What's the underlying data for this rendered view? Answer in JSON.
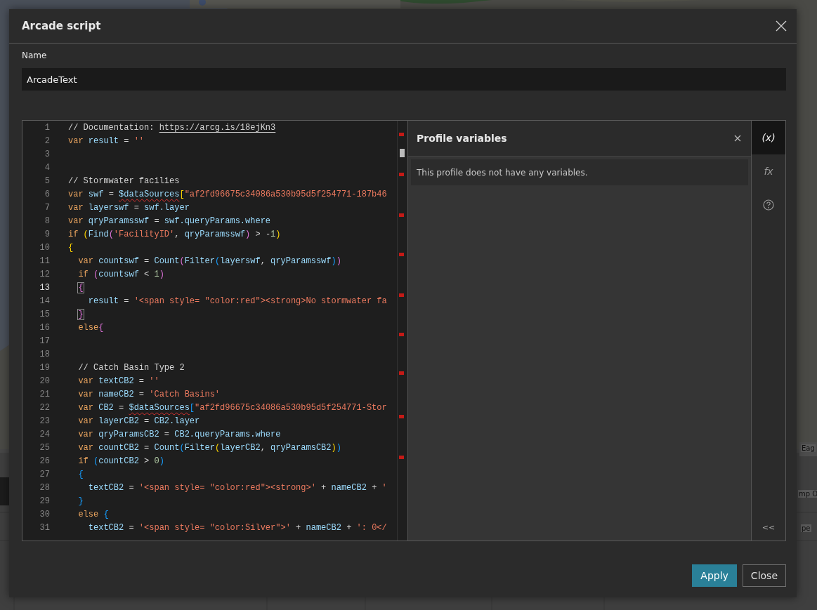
{
  "background": {
    "fragments": [
      "Eag",
      "mp O",
      "pe"
    ]
  },
  "dialog": {
    "title": "Arcade script",
    "name_label": "Name",
    "name_value": "ArcadeText",
    "editor": {
      "lines": [
        {
          "number": "1",
          "current": false,
          "tokens": [
            {
              "text": "// Documentation: ",
              "kind": "cm"
            },
            {
              "text": "https://arcg.is/18ejKn3",
              "kind": "link"
            }
          ]
        },
        {
          "number": "2",
          "current": false,
          "tokens": [
            {
              "text": "var ",
              "kind": "kw"
            },
            {
              "text": "result",
              "kind": "id"
            },
            {
              "text": " = ",
              "kind": "op"
            },
            {
              "text": "''",
              "kind": "str"
            }
          ]
        },
        {
          "number": "3",
          "current": false
        },
        {
          "number": "4",
          "current": false
        },
        {
          "number": "5",
          "current": false,
          "tokens": [
            {
              "text": "// Stormwater facilies",
              "kind": "cm"
            }
          ]
        },
        {
          "number": "6",
          "current": false,
          "tokens": [
            {
              "text": "var ",
              "kind": "kw"
            },
            {
              "text": "swf",
              "kind": "id"
            },
            {
              "text": " = ",
              "kind": "op"
            },
            {
              "text": "$dataSources",
              "kind": "err"
            },
            {
              "text": "[",
              "kind": "p1"
            },
            {
              "text": "\"af2fd96675c34086a530b95d5f254771-187b46",
              "kind": "str"
            }
          ]
        },
        {
          "number": "7",
          "current": false,
          "tokens": [
            {
              "text": "var ",
              "kind": "kw"
            },
            {
              "text": "layerswf",
              "kind": "id"
            },
            {
              "text": " = ",
              "kind": "op"
            },
            {
              "text": "swf.layer",
              "kind": "id"
            }
          ]
        },
        {
          "number": "8",
          "current": false,
          "tokens": [
            {
              "text": "var ",
              "kind": "kw"
            },
            {
              "text": "qryParamsswf",
              "kind": "id"
            },
            {
              "text": " = ",
              "kind": "op"
            },
            {
              "text": "swf.queryParams.where",
              "kind": "id"
            }
          ]
        },
        {
          "number": "9",
          "current": false,
          "tokens": [
            {
              "text": "if ",
              "kind": "kw"
            },
            {
              "text": "(",
              "kind": "p1"
            },
            {
              "text": "Find",
              "kind": "fn"
            },
            {
              "text": "(",
              "kind": "p2"
            },
            {
              "text": "'FacilityID'",
              "kind": "str"
            },
            {
              "text": ", ",
              "kind": "op"
            },
            {
              "text": "qryParamsswf",
              "kind": "id"
            },
            {
              "text": ")",
              "kind": "p2"
            },
            {
              "text": " > -",
              "kind": "op"
            },
            {
              "text": "1",
              "kind": "num"
            },
            {
              "text": ")",
              "kind": "p1"
            }
          ]
        },
        {
          "number": "10",
          "current": false,
          "tokens": [
            {
              "text": "{",
              "kind": "p1"
            }
          ]
        },
        {
          "number": "11",
          "current": false,
          "tokens": [
            {
              "text": "  var ",
              "kind": "kw"
            },
            {
              "text": "countswf",
              "kind": "id"
            },
            {
              "text": " = ",
              "kind": "op"
            },
            {
              "text": "Count",
              "kind": "fn"
            },
            {
              "text": "(",
              "kind": "p2"
            },
            {
              "text": "Filter",
              "kind": "fn"
            },
            {
              "text": "(",
              "kind": "p3"
            },
            {
              "text": "layerswf",
              "kind": "id"
            },
            {
              "text": ", ",
              "kind": "op"
            },
            {
              "text": "qryParamsswf",
              "kind": "id"
            },
            {
              "text": ")",
              "kind": "p3"
            },
            {
              "text": ")",
              "kind": "p2"
            }
          ]
        },
        {
          "number": "12",
          "current": false,
          "tokens": [
            {
              "text": "  if ",
              "kind": "kw"
            },
            {
              "text": "(",
              "kind": "p2"
            },
            {
              "text": "countswf",
              "kind": "id"
            },
            {
              "text": " < ",
              "kind": "op"
            },
            {
              "text": "1",
              "kind": "num"
            },
            {
              "text": ")",
              "kind": "p2"
            }
          ]
        },
        {
          "number": "13",
          "current": true,
          "tokens": [
            {
              "text": "  {",
              "kind": "p2m"
            }
          ]
        },
        {
          "number": "14",
          "current": false,
          "tokens": [
            {
              "text": "    result",
              "kind": "id"
            },
            {
              "text": " = ",
              "kind": "op"
            },
            {
              "text": "'<span style= \"color:red\"><strong>No stormwater fa",
              "kind": "str"
            }
          ]
        },
        {
          "number": "15",
          "current": false,
          "tokens": [
            {
              "text": "  }",
              "kind": "p2m"
            }
          ]
        },
        {
          "number": "16",
          "current": false,
          "tokens": [
            {
              "text": "  else",
              "kind": "kw"
            },
            {
              "text": "{",
              "kind": "p2"
            }
          ]
        },
        {
          "number": "17",
          "current": false
        },
        {
          "number": "18",
          "current": false
        },
        {
          "number": "19",
          "current": false,
          "tokens": [
            {
              "text": "  // Catch Basin Type 2",
              "kind": "cm"
            }
          ]
        },
        {
          "number": "20",
          "current": false,
          "tokens": [
            {
              "text": "  var ",
              "kind": "kw"
            },
            {
              "text": "textCB2",
              "kind": "id"
            },
            {
              "text": " = ",
              "kind": "op"
            },
            {
              "text": "''",
              "kind": "str"
            }
          ]
        },
        {
          "number": "21",
          "current": false,
          "tokens": [
            {
              "text": "  var ",
              "kind": "kw"
            },
            {
              "text": "nameCB2",
              "kind": "id"
            },
            {
              "text": " = ",
              "kind": "op"
            },
            {
              "text": "'Catch Basins'",
              "kind": "str"
            }
          ]
        },
        {
          "number": "22",
          "current": false,
          "tokens": [
            {
              "text": "  var ",
              "kind": "kw"
            },
            {
              "text": "CB2",
              "kind": "id"
            },
            {
              "text": " = ",
              "kind": "op"
            },
            {
              "text": "$dataSources",
              "kind": "err"
            },
            {
              "text": "[",
              "kind": "p3"
            },
            {
              "text": "\"af2fd96675c34086a530b95d5f254771-Stor",
              "kind": "str"
            }
          ]
        },
        {
          "number": "23",
          "current": false,
          "tokens": [
            {
              "text": "  var ",
              "kind": "kw"
            },
            {
              "text": "layerCB2",
              "kind": "id"
            },
            {
              "text": " = ",
              "kind": "op"
            },
            {
              "text": "CB2.layer",
              "kind": "id"
            }
          ]
        },
        {
          "number": "24",
          "current": false,
          "tokens": [
            {
              "text": "  var ",
              "kind": "kw"
            },
            {
              "text": "qryParamsCB2",
              "kind": "id"
            },
            {
              "text": " = ",
              "kind": "op"
            },
            {
              "text": "CB2.queryParams.where",
              "kind": "id"
            }
          ]
        },
        {
          "number": "25",
          "current": false,
          "tokens": [
            {
              "text": "  var ",
              "kind": "kw"
            },
            {
              "text": "countCB2",
              "kind": "id"
            },
            {
              "text": " = ",
              "kind": "op"
            },
            {
              "text": "Count",
              "kind": "fn"
            },
            {
              "text": "(",
              "kind": "p3"
            },
            {
              "text": "Filter",
              "kind": "fn"
            },
            {
              "text": "(",
              "kind": "p1"
            },
            {
              "text": "layerCB2",
              "kind": "id"
            },
            {
              "text": ", ",
              "kind": "op"
            },
            {
              "text": "qryParamsCB2",
              "kind": "id"
            },
            {
              "text": ")",
              "kind": "p1"
            },
            {
              "text": ")",
              "kind": "p3"
            }
          ]
        },
        {
          "number": "26",
          "current": false,
          "tokens": [
            {
              "text": "  if ",
              "kind": "kw"
            },
            {
              "text": "(",
              "kind": "p3"
            },
            {
              "text": "countCB2",
              "kind": "id"
            },
            {
              "text": " > ",
              "kind": "op"
            },
            {
              "text": "0",
              "kind": "num"
            },
            {
              "text": ")",
              "kind": "p3"
            }
          ]
        },
        {
          "number": "27",
          "current": false,
          "tokens": [
            {
              "text": "  {",
              "kind": "p3"
            }
          ]
        },
        {
          "number": "28",
          "current": false,
          "tokens": [
            {
              "text": "    textCB2",
              "kind": "id"
            },
            {
              "text": " = ",
              "kind": "op"
            },
            {
              "text": "'<span style= \"color:red\"><strong>'",
              "kind": "str"
            },
            {
              "text": " + ",
              "kind": "op"
            },
            {
              "text": "nameCB2",
              "kind": "id"
            },
            {
              "text": " + ",
              "kind": "op"
            },
            {
              "text": "'",
              "kind": "str"
            }
          ]
        },
        {
          "number": "29",
          "current": false,
          "tokens": [
            {
              "text": "  }",
              "kind": "p3"
            }
          ]
        },
        {
          "number": "30",
          "current": false,
          "tokens": [
            {
              "text": "  else ",
              "kind": "kw"
            },
            {
              "text": "{",
              "kind": "p3"
            }
          ]
        },
        {
          "number": "31",
          "current": false,
          "tokens": [
            {
              "text": "    textCB2",
              "kind": "id"
            },
            {
              "text": " = ",
              "kind": "op"
            },
            {
              "text": "'<span style= \"color:Silver\">'",
              "kind": "str"
            },
            {
              "text": " + ",
              "kind": "op"
            },
            {
              "text": "nameCB2",
              "kind": "id"
            },
            {
              "text": " + ",
              "kind": "op"
            },
            {
              "text": "': 0</",
              "kind": "str"
            }
          ]
        }
      ]
    },
    "panel": {
      "title": "Profile variables",
      "message": "This profile does not have any variables."
    },
    "rail": [
      {
        "kind": "variables",
        "label": "(x)",
        "selected": true
      },
      {
        "kind": "functions",
        "label": "fx",
        "selected": false
      },
      {
        "kind": "help",
        "selected": false
      }
    ],
    "collapse": "<<",
    "buttons": [
      {
        "label": "Apply",
        "kind": "primary"
      },
      {
        "label": "Close",
        "kind": "secondary"
      }
    ]
  }
}
